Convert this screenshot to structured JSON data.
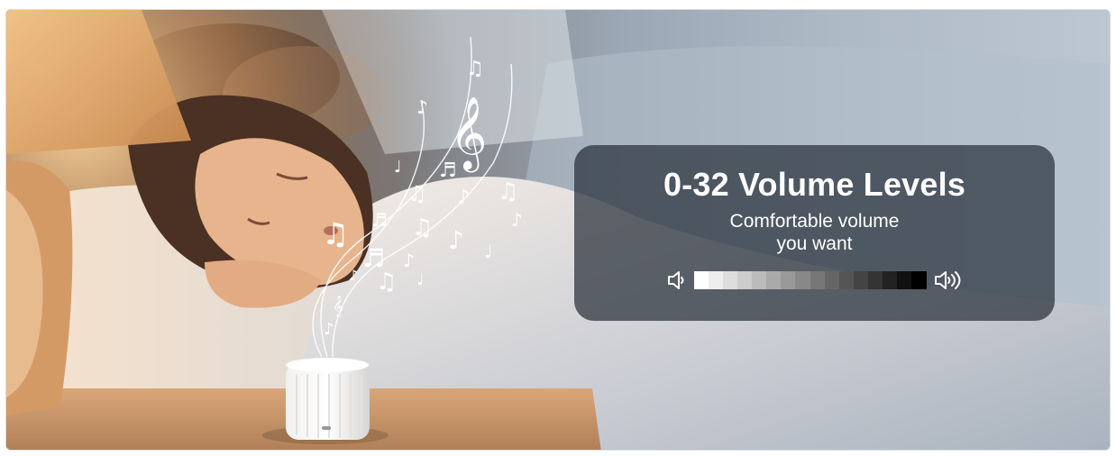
{
  "promo": {
    "headline": "0-32 Volume Levels",
    "subline_1": "Comfortable volume",
    "subline_2": "you want"
  },
  "volume_meter": {
    "levels": 32,
    "left_icon": "volume-low-icon",
    "right_icon": "volume-high-icon"
  },
  "colors": {
    "card_bg": "#28303A",
    "meter_light": "#FFFFFF",
    "meter_dark": "#000000",
    "lamp_glow": "#F2B46A"
  }
}
